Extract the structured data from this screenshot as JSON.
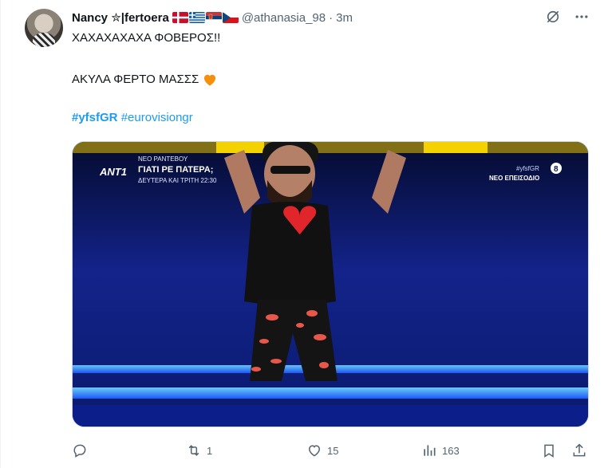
{
  "author": {
    "display_name": "Nancy ✮|fertoera",
    "flags": [
      "denmark-flag",
      "greece-flag",
      "serbia-flag",
      "czech-flag"
    ],
    "handle": "@athanasia_98",
    "separator": "·",
    "timestamp": "3m"
  },
  "tweet": {
    "line1": "ΧΑΧΑΧΑΧΑΧΑ ΦΟΒΕΡΟΣ!!",
    "line2": "ΑΚΥΛΑ ΦΕΡΤΟ ΜΑΣΣΣ",
    "emoji": "orange-heart-icon",
    "hashtag1": "#yfsfGR",
    "hashtag2": "#eurovisiongr"
  },
  "media": {
    "channel_logo": "ANT1",
    "promo_small": "ΝΕΟ ΡΑΝΤΕΒΟΥ",
    "promo_title": "ΓΙΑΤΙ ΡΕ ΠΑΤΕΡΑ;",
    "promo_schedule": "ΔΕΥΤΕΡΑ ΚΑΙ ΤΡΙΤΗ 22:30",
    "hashtag_overlay": "#yfsfGR",
    "episode_label": "ΝΕΟ ΕΠΕΙΣΟΔΙΟ",
    "rating_badge": "8"
  },
  "actions": {
    "replies": "",
    "retweets": "1",
    "likes": "15",
    "views": "163"
  },
  "colors": {
    "accent": "#1d9bf0",
    "muted": "#536471",
    "text": "#0f1419"
  }
}
